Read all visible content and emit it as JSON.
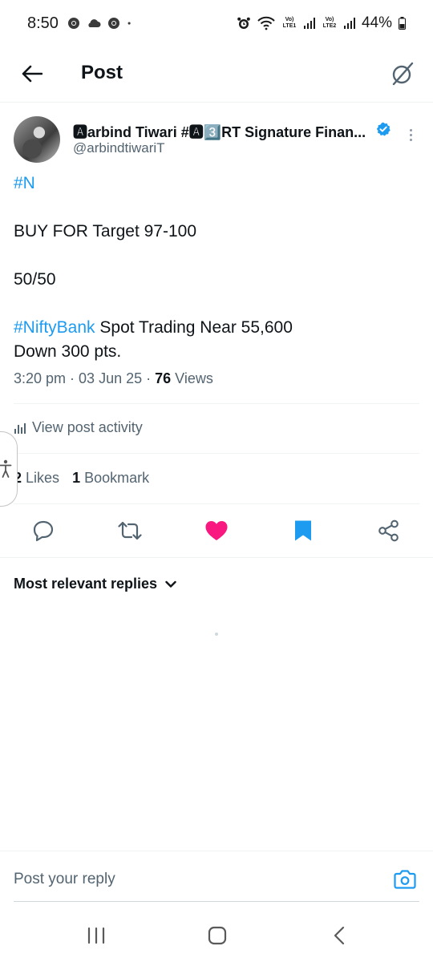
{
  "status_bar": {
    "time": "8:50",
    "left_icons": [
      "chrome-icon",
      "cloud-icon",
      "chrome-icon",
      "dot-icon"
    ],
    "sim1_label": "Vo) LTE1",
    "sim2_label": "Vo) LTE2",
    "battery": "44%"
  },
  "header": {
    "title": "Post",
    "back_icon": "arrow-left-icon",
    "grok_icon": "grok-icon"
  },
  "post": {
    "author_name": "🅰arbind Tiwari #🅰3️⃣RT Signature Finan...",
    "author_handle": "@arbindtiwariT",
    "line1": "#N",
    "line2": "BUY FOR Target 97-100",
    "line3": "50/50",
    "line4_hashtag": "#NiftyBank",
    "line4_text": " Spot Trading Near 55,600",
    "line5": "Down 300 pts.",
    "time": "3:20 pm",
    "date": "03 Jun 25",
    "views_count": "76",
    "views_label": "Views"
  },
  "activity": {
    "label": "View post activity"
  },
  "stats": {
    "likes_count": "2",
    "likes_label": "Likes",
    "bookmarks_count": "1",
    "bookmarks_label": "Bookmark"
  },
  "colors": {
    "accent": "#1d9bf0",
    "like": "#f91880",
    "text": "#0f1419",
    "muted": "#536471"
  },
  "replies": {
    "sort_label": "Most relevant replies"
  },
  "reply_bar": {
    "placeholder": "Post your reply"
  }
}
